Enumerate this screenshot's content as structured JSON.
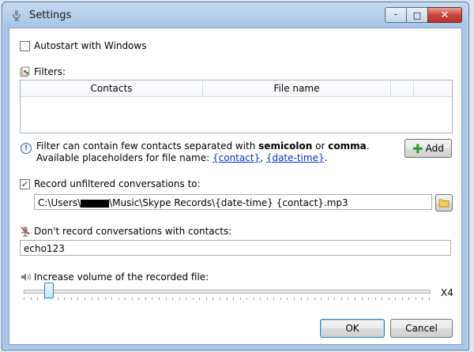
{
  "window": {
    "title": "Settings",
    "minimize_glyph": "–",
    "maximize_glyph": "□",
    "close_glyph": "✕"
  },
  "autostart": {
    "label": "Autostart with Windows",
    "checked": false
  },
  "filters": {
    "label": "Filters:",
    "columns": [
      "Contacts",
      "File name"
    ]
  },
  "hint": {
    "line1_a": "Filter can contain few contacts separated with ",
    "line1_b": "semicolon",
    "line1_c": " or ",
    "line1_d": "comma",
    "line1_e": ".",
    "line2_a": "Available placeholders for file name: ",
    "placeholder_1": "{contact}",
    "placeholder_sep": ", ",
    "placeholder_2": "{date-time}",
    "line2_end": "."
  },
  "add_button": {
    "label": "Add",
    "icon": "plus-icon"
  },
  "record_unfiltered": {
    "label": "Record unfiltered conversations to:",
    "checked": true,
    "path_prefix": "C:\\Users\\",
    "path_suffix": "\\Music\\Skype Records\\{date-time} {contact}.mp3"
  },
  "dont_record": {
    "label": "Don't record conversations with contacts:",
    "value": "echo123"
  },
  "volume": {
    "label": "Increase volume of the recorded file:",
    "max_label": "X4",
    "level": 0.06
  },
  "ok_button": {
    "label": "OK"
  },
  "cancel_button": {
    "label": "Cancel"
  },
  "colors": {
    "accent": "#3c7fb1",
    "link": "#0033cc",
    "close": "#c9463a"
  }
}
